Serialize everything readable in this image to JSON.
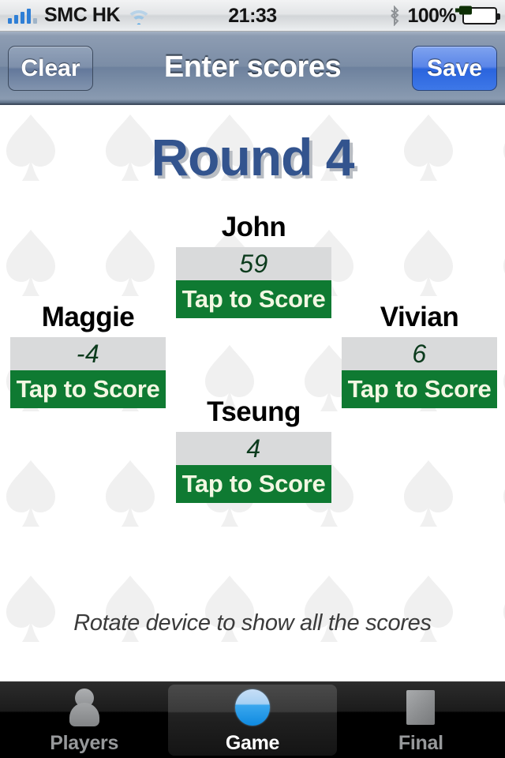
{
  "status_bar": {
    "carrier": "SMC HK",
    "signal_icon": "signal-bars-icon",
    "wifi_icon": "wifi-icon",
    "time": "21:33",
    "bluetooth_icon": "bluetooth-icon",
    "battery_percent": "100%",
    "battery_icon": "battery-charging-icon"
  },
  "navbar": {
    "clear_label": "Clear",
    "title": "Enter scores",
    "save_label": "Save"
  },
  "content": {
    "round_title": "Round 4",
    "tap_label": "Tap to Score",
    "hint": "Rotate device to show all the scores",
    "players": [
      {
        "name": "John",
        "score": "59"
      },
      {
        "name": "Maggie",
        "score": "-4"
      },
      {
        "name": "Vivian",
        "score": "6"
      },
      {
        "name": "Tseung",
        "score": "4"
      }
    ]
  },
  "tabbar": {
    "tabs": [
      {
        "label": "Players",
        "icon": "person-icon",
        "selected": false
      },
      {
        "label": "Game",
        "icon": "blue-circle-icon",
        "selected": true
      },
      {
        "label": "Final",
        "icon": "card-icon",
        "selected": false
      }
    ]
  },
  "colors": {
    "score_button_green": "#0f7a32",
    "score_value_green": "#0c3b1d",
    "score_field_gray": "#d9dadb",
    "round_title_blue": "#33548e",
    "round_title_shadow": "#b9bdc3",
    "save_button_blue": "#2a64dd",
    "navbar_blue_gray": "#7b8da6",
    "tab_selected_text": "#ffffff",
    "tab_text": "#97999b",
    "felt_pattern": "#f0f0f0"
  }
}
